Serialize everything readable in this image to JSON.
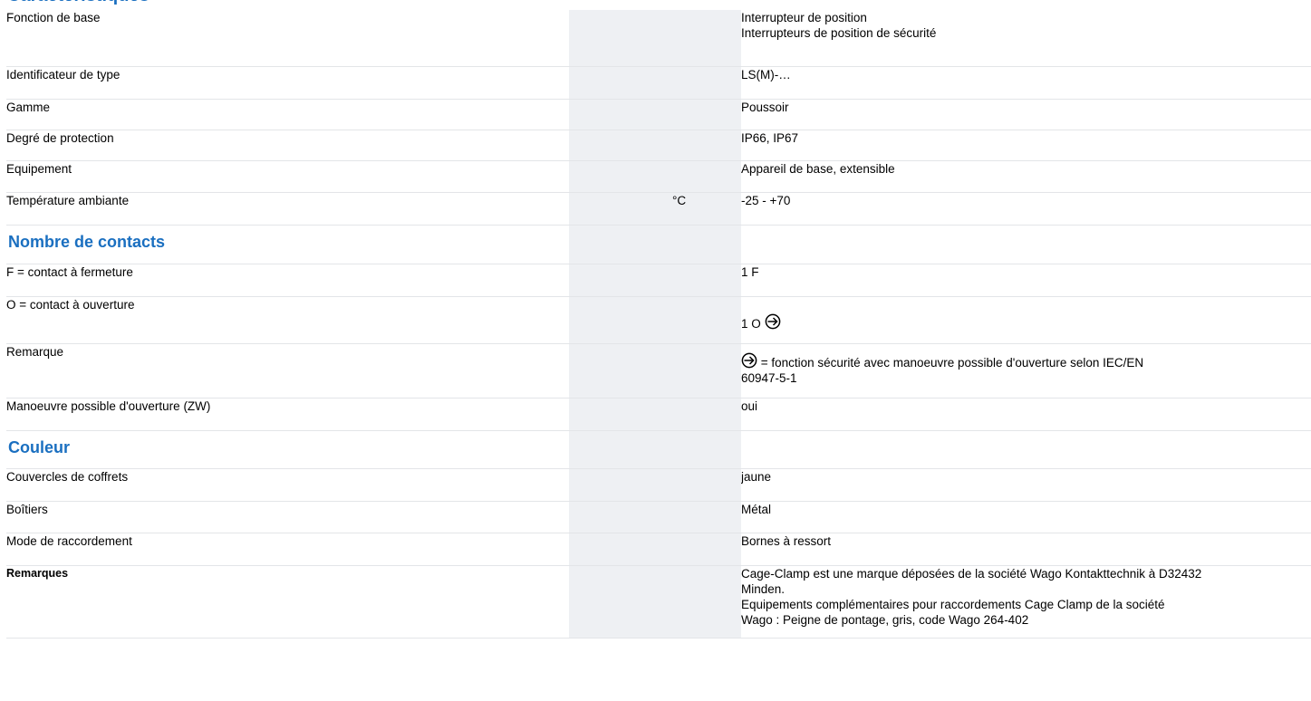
{
  "section_title": "Caractéristiques",
  "rows": [
    {
      "label": "Fonction de base",
      "unit": "",
      "value_lines": [
        "Interrupteur de position",
        "Interrupteurs de position de sécurité"
      ]
    },
    {
      "label": "Identificateur de type",
      "unit": "",
      "value": "LS(M)-…"
    },
    {
      "label": "Gamme",
      "unit": "",
      "value": "Poussoir"
    },
    {
      "label": "Degré de protection",
      "unit": "",
      "value": "IP66, IP67"
    },
    {
      "label": "Equipement",
      "unit": "",
      "value": "Appareil de base, extensible"
    },
    {
      "label": "Température ambiante",
      "unit": "°C",
      "value": "-25 - +70"
    }
  ],
  "contacts": {
    "heading": "Nombre de contacts",
    "f_label": "F = contact à fermeture",
    "f_value": "1 F",
    "o_label": "O = contact à ouverture",
    "o_value": "1 O",
    "note_label": "Remarque",
    "note_value_a": " = fonction sécurité avec manoeuvre possible d'ouverture selon IEC/EN",
    "note_value_b": "60947-5-1"
  },
  "opening": {
    "label": "Manoeuvre possible d'ouverture (ZW)",
    "value": "oui"
  },
  "color": {
    "heading": "Couleur",
    "cover_label": "Couvercles de coffrets",
    "cover_value": "jaune"
  },
  "housing": {
    "label": "Boîtiers",
    "value": "Métal"
  },
  "connection": {
    "label": "Mode de raccordement",
    "value": "Bornes à ressort"
  },
  "remarks": {
    "label": "Remarques",
    "lines": [
      "Cage-Clamp est une marque déposées de la société Wago Kontakttechnik à D32432",
      "Minden.",
      "Equipements complémentaires pour raccordements Cage Clamp de la société",
      "Wago : Peigne de pontage, gris, code Wago 264-402"
    ]
  },
  "icons": {
    "safety_symbol": "positive-opening-arrow-icon"
  },
  "colors": {
    "heading": "#1a6fc0",
    "shade": "#eef0f3",
    "rule": "#e3e5e8"
  }
}
